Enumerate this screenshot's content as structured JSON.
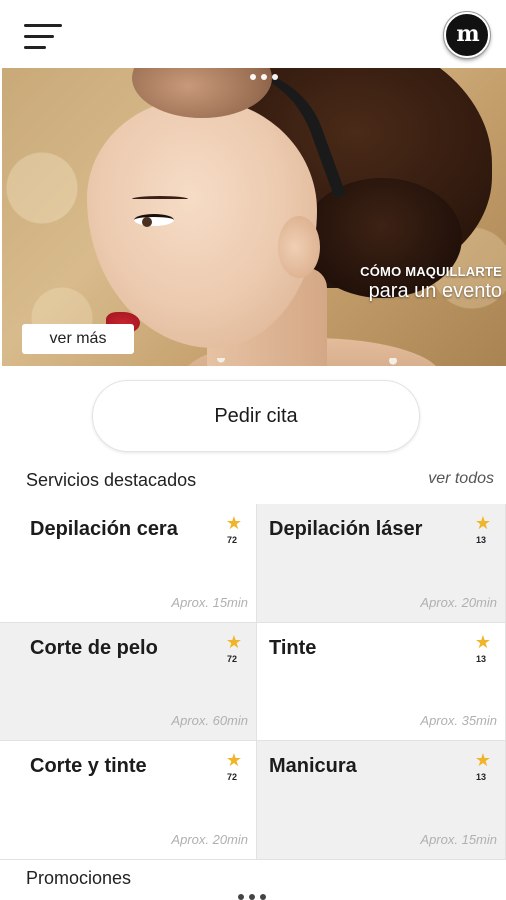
{
  "header": {
    "menu_icon": "hamburger-menu-icon",
    "logo_text": "m"
  },
  "banner": {
    "title_line1": "CÓMO MAQUILLARTE",
    "title_line2": "para un evento",
    "see_more_label": "ver más",
    "slide_count": 3
  },
  "appointment_label": "Pedir cita",
  "featured": {
    "title": "Servicios destacados",
    "see_all_label": "ver todos",
    "services": [
      {
        "name": "Depilación cera",
        "count": "72",
        "time": "Aprox. 15min",
        "icon": "star-icon"
      },
      {
        "name": "Depilación láser",
        "count": "13",
        "time": "Aprox. 20min",
        "icon": "star-icon"
      },
      {
        "name": "Corte de pelo",
        "count": "72",
        "time": "Aprox. 60min",
        "icon": "star-icon"
      },
      {
        "name": "Tinte",
        "count": "13",
        "time": "Aprox. 35min",
        "icon": "star-icon"
      },
      {
        "name": "Corte y tinte",
        "count": "72",
        "time": "Aprox. 20min",
        "icon": "star-icon"
      },
      {
        "name": "Manicura",
        "count": "13",
        "time": "Aprox. 15min",
        "icon": "star-icon"
      }
    ]
  },
  "promotions": {
    "title": "Promociones"
  },
  "colors": {
    "star": "#f0b429",
    "card_grey": "#f0f0f0",
    "time_text": "#b0b0b0"
  }
}
